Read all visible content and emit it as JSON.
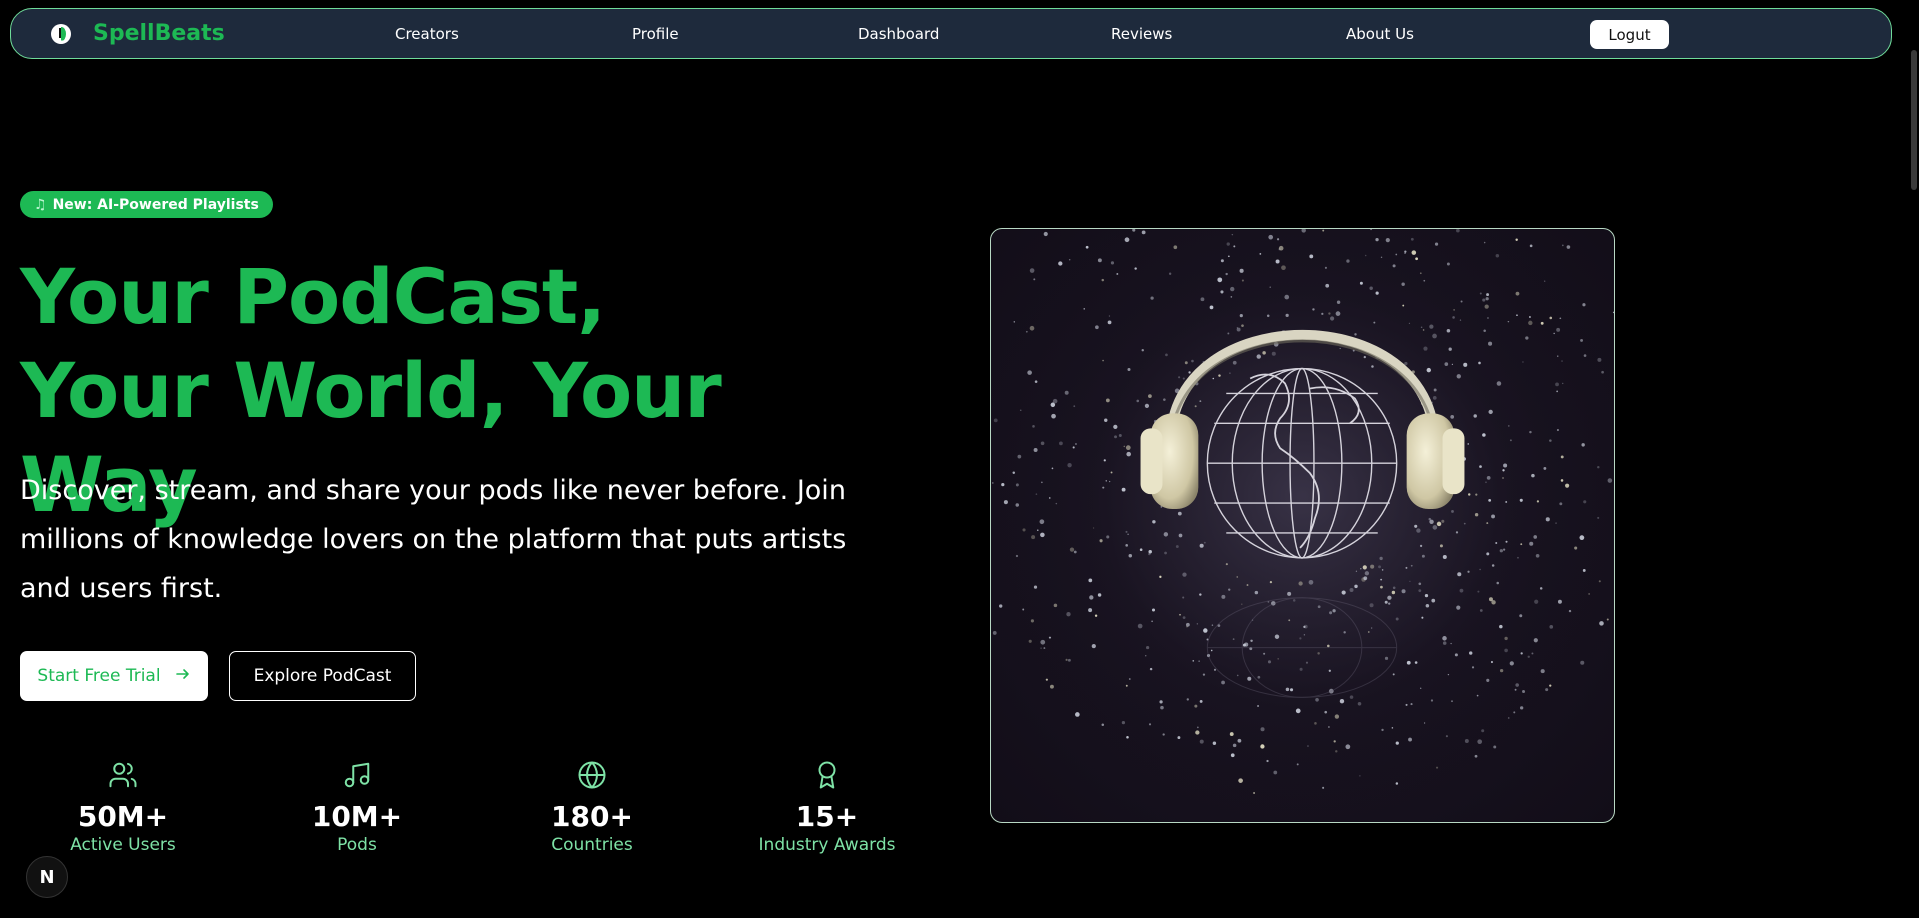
{
  "nav": {
    "brand": "SpellBeats",
    "links": [
      "Creators",
      "Profile",
      "Dashboard",
      "Reviews",
      "About Us"
    ],
    "logout_label": "Logut"
  },
  "hero": {
    "badge": "New: AI-Powered Playlists",
    "title": "Your PodCast, Your World, Your Way",
    "subtitle": "Discover, stream, and share your pods like never before. Join millions of knowledge lovers on the platform that puts artists and users first.",
    "primary_cta": "Start Free Trial",
    "secondary_cta": "Explore PodCast"
  },
  "stats": [
    {
      "icon": "users-icon",
      "value": "50M+",
      "label": "Active Users"
    },
    {
      "icon": "music-note-icon",
      "value": "10M+",
      "label": "Pods"
    },
    {
      "icon": "globe-icon",
      "value": "180+",
      "label": "Countries"
    },
    {
      "icon": "award-icon",
      "value": "15+",
      "label": "Industry Awards"
    }
  ],
  "colors": {
    "accent": "#1db954",
    "nav_bg": "#1e2a3c",
    "stat_label": "#7ee2a6",
    "background": "#000000"
  },
  "dev_indicator": "N"
}
